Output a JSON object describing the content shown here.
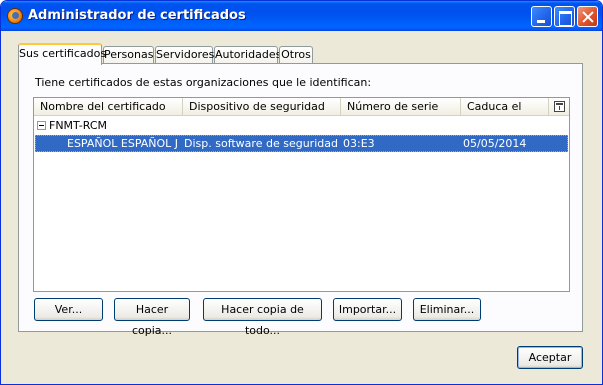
{
  "window": {
    "title": "Administrador de certificados"
  },
  "tabs": [
    {
      "label": "Sus certificados",
      "active": true
    },
    {
      "label": "Personas",
      "active": false
    },
    {
      "label": "Servidores",
      "active": false
    },
    {
      "label": "Autoridades",
      "active": false
    },
    {
      "label": "Otros",
      "active": false
    }
  ],
  "panel": {
    "intro": "Tiene certificados de estas organizaciones que le identifican:"
  },
  "table": {
    "columns": [
      "Nombre del certificado",
      "Dispositivo de seguridad",
      "Número de serie",
      "Caduca el"
    ],
    "groups": [
      {
        "name": "FNMT-RCM",
        "rows": [
          {
            "name": "ESPAÑOL ESPAÑOL J...",
            "device": "Disp. software de seguridad",
            "serial": "03:E3",
            "expires": "05/05/2014",
            "selected": true
          }
        ]
      }
    ]
  },
  "buttons": {
    "view": "Ver...",
    "backup": "Hacer copia...",
    "backup_all": "Hacer copia de todo...",
    "import": "Importar...",
    "delete": "Eliminar...",
    "accept": "Aceptar"
  }
}
